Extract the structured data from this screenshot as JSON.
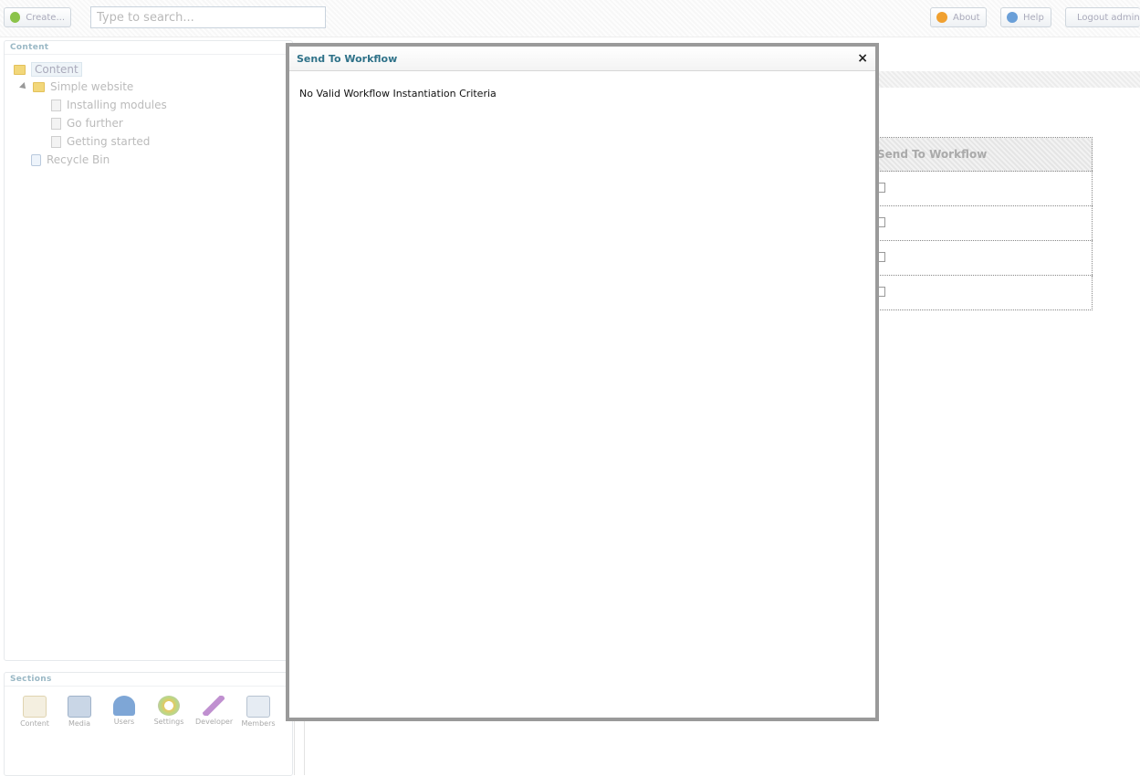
{
  "toolbar": {
    "create_label": "Create...",
    "search_placeholder": "Type to search...",
    "about_label": "About",
    "help_label": "Help",
    "logout_label": "Logout admin"
  },
  "content_panel": {
    "title": "Content",
    "tree": {
      "root": "Content",
      "site": "Simple website",
      "pages": [
        "Installing modules",
        "Go further",
        "Getting started"
      ],
      "recycle_bin": "Recycle Bin"
    }
  },
  "sections_panel": {
    "title": "Sections",
    "items": [
      "Content",
      "Media",
      "Users",
      "Settings",
      "Developer",
      "Members"
    ]
  },
  "background_table": {
    "header": "Send To Workflow",
    "rows": 4
  },
  "modal": {
    "title": "Send To Workflow",
    "close_label": "×",
    "message": "No Valid Workflow Instantiation Criteria"
  },
  "colors": {
    "modal_title": "#2f7289",
    "modal_border": "#9a9a9a",
    "panel_heading": "#9ab8c5"
  }
}
